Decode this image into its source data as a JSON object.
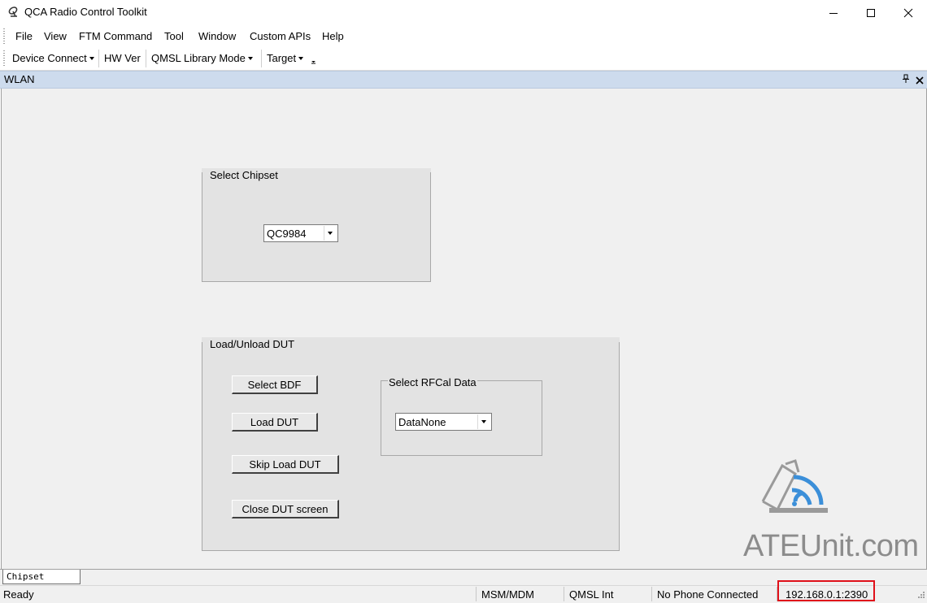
{
  "window": {
    "title": "QCA Radio Control Toolkit",
    "controls": [
      "minimize",
      "maximize",
      "close"
    ]
  },
  "menu": {
    "items": [
      "File",
      "View",
      "FTM Command",
      "Tool",
      "Window",
      "Custom APIs",
      "Help"
    ]
  },
  "toolbar": {
    "device_connect": "Device Connect",
    "hw_ver": "HW Ver",
    "qmsl_mode": "QMSL Library Mode",
    "target": "Target"
  },
  "pane": {
    "title": "WLAN"
  },
  "chipset_group": {
    "label": "Select Chipset",
    "selected": "QC9984"
  },
  "dut_group": {
    "label": "Load/Unload DUT",
    "buttons": [
      "Select BDF",
      "Load DUT",
      "Skip Load DUT",
      "Close DUT screen"
    ],
    "rfcal_label": "Select RFCal Data",
    "rfcal_selected": "DataNone"
  },
  "tabs": [
    "Chipset Select"
  ],
  "status": {
    "ready": "Ready",
    "msm": "MSM/MDM",
    "qmsl": "QMSL Int",
    "phone": "No Phone Connected",
    "ip": "192.168.0.1:2390"
  },
  "watermark": {
    "text": "ATEUnit.com"
  },
  "colors": {
    "pane_header": "#cddbed",
    "client_bg": "#f0f0f0",
    "group_bg": "#e3e3e3",
    "highlight": "#e0101a"
  }
}
